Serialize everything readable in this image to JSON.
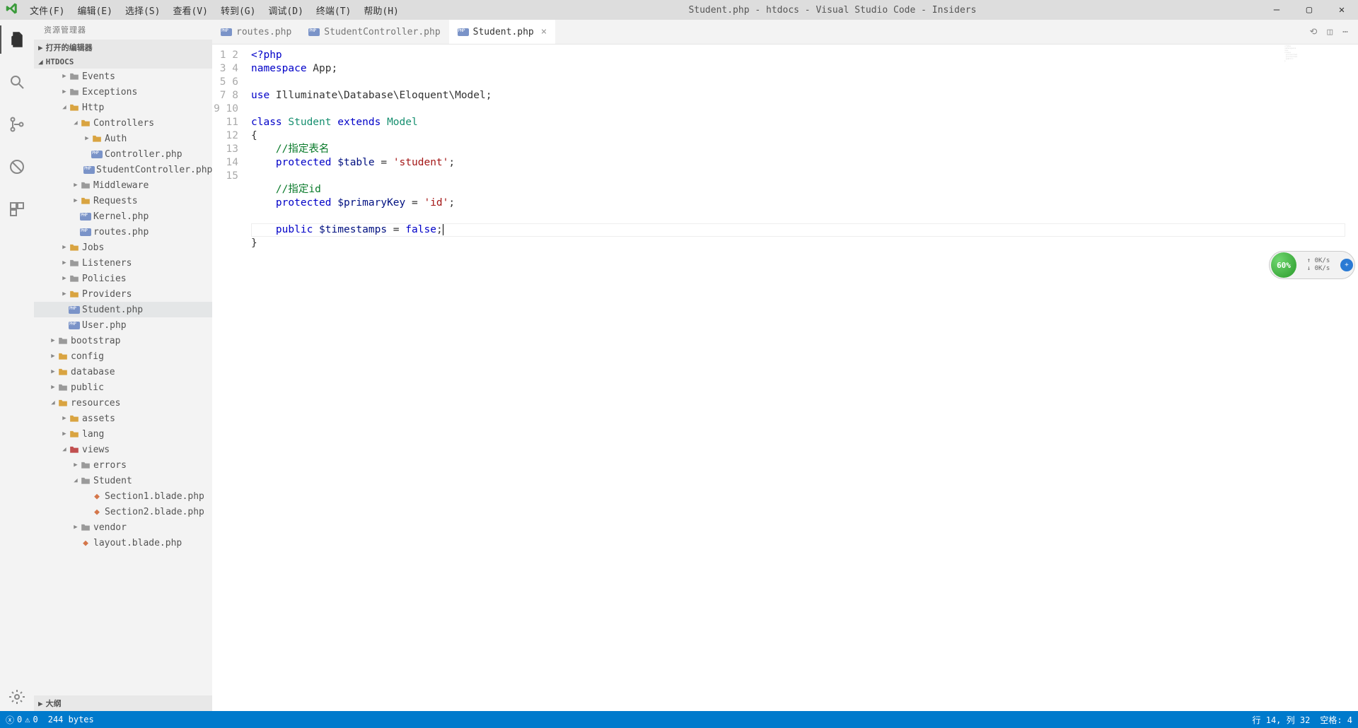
{
  "title": "Student.php - htdocs - Visual Studio Code - Insiders",
  "menu": [
    "文件(F)",
    "编辑(E)",
    "选择(S)",
    "查看(V)",
    "转到(G)",
    "调试(D)",
    "终端(T)",
    "帮助(H)"
  ],
  "sidebar": {
    "header": "资源管理器",
    "sections": {
      "open_editors": "打开的编辑器",
      "project": "HTDOCS",
      "outline": "大纲"
    },
    "tree": [
      {
        "d": 1,
        "t": "f",
        "e": 0,
        "n": "Events",
        "c": "g"
      },
      {
        "d": 1,
        "t": "f",
        "e": 0,
        "n": "Exceptions",
        "c": "g"
      },
      {
        "d": 1,
        "t": "f",
        "e": 1,
        "n": "Http",
        "c": "y"
      },
      {
        "d": 2,
        "t": "f",
        "e": 1,
        "n": "Controllers",
        "c": "y"
      },
      {
        "d": 3,
        "t": "f",
        "e": 0,
        "n": "Auth",
        "c": "y"
      },
      {
        "d": 3,
        "t": "p",
        "n": "Controller.php"
      },
      {
        "d": 3,
        "t": "p",
        "n": "StudentController.php"
      },
      {
        "d": 2,
        "t": "f",
        "e": 0,
        "n": "Middleware",
        "c": "g"
      },
      {
        "d": 2,
        "t": "f",
        "e": 0,
        "n": "Requests",
        "c": "y"
      },
      {
        "d": 2,
        "t": "p",
        "n": "Kernel.php"
      },
      {
        "d": 2,
        "t": "p",
        "n": "routes.php"
      },
      {
        "d": 1,
        "t": "f",
        "e": 0,
        "n": "Jobs",
        "c": "y"
      },
      {
        "d": 1,
        "t": "f",
        "e": 0,
        "n": "Listeners",
        "c": "g"
      },
      {
        "d": 1,
        "t": "f",
        "e": 0,
        "n": "Policies",
        "c": "g"
      },
      {
        "d": 1,
        "t": "f",
        "e": 0,
        "n": "Providers",
        "c": "y"
      },
      {
        "d": 1,
        "t": "p",
        "n": "Student.php",
        "sel": 1
      },
      {
        "d": 1,
        "t": "p",
        "n": "User.php"
      },
      {
        "d": 0,
        "t": "f",
        "e": 0,
        "n": "bootstrap",
        "c": "g"
      },
      {
        "d": 0,
        "t": "f",
        "e": 0,
        "n": "config",
        "c": "y"
      },
      {
        "d": 0,
        "t": "f",
        "e": 0,
        "n": "database",
        "c": "y"
      },
      {
        "d": 0,
        "t": "f",
        "e": 0,
        "n": "public",
        "c": "g"
      },
      {
        "d": 0,
        "t": "f",
        "e": 1,
        "n": "resources",
        "c": "y"
      },
      {
        "d": 1,
        "t": "f",
        "e": 0,
        "n": "assets",
        "c": "y"
      },
      {
        "d": 1,
        "t": "f",
        "e": 0,
        "n": "lang",
        "c": "y"
      },
      {
        "d": 1,
        "t": "f",
        "e": 1,
        "n": "views",
        "c": "r"
      },
      {
        "d": 2,
        "t": "f",
        "e": 0,
        "n": "errors",
        "c": "g"
      },
      {
        "d": 2,
        "t": "f",
        "e": 1,
        "n": "Student",
        "c": "g"
      },
      {
        "d": 3,
        "t": "b",
        "n": "Section1.blade.php"
      },
      {
        "d": 3,
        "t": "b",
        "n": "Section2.blade.php"
      },
      {
        "d": 2,
        "t": "f",
        "e": 0,
        "n": "vendor",
        "c": "g"
      },
      {
        "d": 2,
        "t": "b",
        "n": "layout.blade.php"
      }
    ]
  },
  "tabs": [
    {
      "label": "routes.php",
      "active": false
    },
    {
      "label": "StudentController.php",
      "active": false
    },
    {
      "label": "Student.php",
      "active": true
    }
  ],
  "code": {
    "lines": [
      [
        [
          "<?php",
          "kw"
        ]
      ],
      [
        [
          "namespace",
          "kw"
        ],
        [
          " App;",
          ""
        ]
      ],
      [],
      [
        [
          "use",
          "kw"
        ],
        [
          " Illuminate\\Database\\Eloquent\\Model;",
          ""
        ]
      ],
      [],
      [
        [
          "class",
          "kw"
        ],
        [
          " Student ",
          "cls"
        ],
        [
          "extends",
          "kw"
        ],
        [
          " Model",
          "cls"
        ]
      ],
      [
        [
          "{",
          ""
        ]
      ],
      [
        [
          "    ",
          ""
        ],
        [
          "//指定表名",
          "cmt"
        ]
      ],
      [
        [
          "    ",
          ""
        ],
        [
          "protected",
          "kw"
        ],
        [
          " ",
          ""
        ],
        [
          "$table",
          "var"
        ],
        [
          " = ",
          ""
        ],
        [
          "'student'",
          "str"
        ],
        [
          ";",
          ""
        ]
      ],
      [],
      [
        [
          "    ",
          ""
        ],
        [
          "//指定id",
          "cmt"
        ]
      ],
      [
        [
          "    ",
          ""
        ],
        [
          "protected",
          "kw"
        ],
        [
          " ",
          ""
        ],
        [
          "$primaryKey",
          "var"
        ],
        [
          " = ",
          ""
        ],
        [
          "'id'",
          "str"
        ],
        [
          ";",
          ""
        ]
      ],
      [],
      [
        [
          "    ",
          ""
        ],
        [
          "public",
          "kw"
        ],
        [
          " ",
          ""
        ],
        [
          "$timestamps",
          "var"
        ],
        [
          " = ",
          ""
        ],
        [
          "false",
          "kw"
        ],
        [
          ";",
          ""
        ]
      ],
      [
        [
          "}",
          ""
        ]
      ]
    ],
    "cursor_line": 14
  },
  "status": {
    "errors": "0",
    "warnings": "0",
    "bytes": "244 bytes",
    "ln_col": "行 14, 列 32",
    "spaces": "空格: 4"
  },
  "widget": {
    "pct": "60%",
    "up": "0K/s",
    "down": "0K/s"
  }
}
